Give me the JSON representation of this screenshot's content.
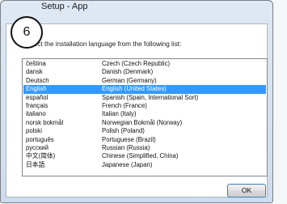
{
  "window": {
    "title": "Setup - App"
  },
  "step_badge": "6",
  "instruction": "Select the installation language from the following list:",
  "languages": [
    {
      "native": "čeština",
      "english": "Czech (Czech Republic)"
    },
    {
      "native": "dansk",
      "english": "Danish (Denmark)"
    },
    {
      "native": "Deutsch",
      "english": "German (Germany)"
    },
    {
      "native": "English",
      "english": "English (United States)"
    },
    {
      "native": "español",
      "english": "Spanish (Spain, International Sort)"
    },
    {
      "native": "français",
      "english": "French (France)"
    },
    {
      "native": "italiano",
      "english": "Italian (Italy)"
    },
    {
      "native": "norsk bokmål",
      "english": "Norwegian Bokmål (Norway)"
    },
    {
      "native": "polski",
      "english": "Polish (Poland)"
    },
    {
      "native": "português",
      "english": "Portuguese (Brazil)"
    },
    {
      "native": "русский",
      "english": "Russian (Russia)"
    },
    {
      "native": "中文(简体)",
      "english": "Chinese (Simplified, China)"
    },
    {
      "native": "日本語",
      "english": "Japanese (Japan)"
    }
  ],
  "selected_language": "English",
  "ok_label": "OK",
  "colors": {
    "selection": "#3399ff",
    "button_border": "#3c7fb1"
  }
}
